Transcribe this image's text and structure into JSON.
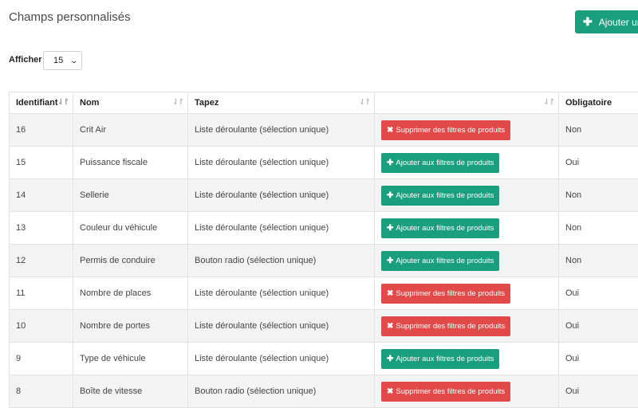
{
  "page": {
    "title": "Champs personnalisés",
    "add_button_label": "Ajouter un ch"
  },
  "length_control": {
    "label": "Afficher",
    "value": "15"
  },
  "table": {
    "columns": [
      "Identifiant",
      "Nom",
      "Tapez",
      "",
      "Obligatoire"
    ],
    "rows": [
      {
        "id": "16",
        "name": "Crit Air",
        "type": "Liste déroulante (sélection unique)",
        "action": "remove",
        "action_label": "Supprimer des filtres de produits",
        "required": "Non"
      },
      {
        "id": "15",
        "name": "Puissance fiscale",
        "type": "Liste déroulante (sélection unique)",
        "action": "add",
        "action_label": "Ajouter aux filtres de produits",
        "required": "Oui"
      },
      {
        "id": "14",
        "name": "Sellerie",
        "type": "Liste déroulante (sélection unique)",
        "action": "add",
        "action_label": "Ajouter aux filtres de produits",
        "required": "Non"
      },
      {
        "id": "13",
        "name": "Couleur du véhicule",
        "type": "Liste déroulante (sélection unique)",
        "action": "add",
        "action_label": "Ajouter aux filtres de produits",
        "required": "Non"
      },
      {
        "id": "12",
        "name": "Permis de conduire",
        "type": "Bouton radio (sélection unique)",
        "action": "add",
        "action_label": "Ajouter aux filtres de produits",
        "required": "Non"
      },
      {
        "id": "11",
        "name": "Nombre de places",
        "type": "Liste déroulante (sélection unique)",
        "action": "remove",
        "action_label": "Supprimer des filtres de produits",
        "required": "Oui"
      },
      {
        "id": "10",
        "name": "Nombre de portes",
        "type": "Liste déroulante (sélection unique)",
        "action": "remove",
        "action_label": "Supprimer des filtres de produits",
        "required": "Oui"
      },
      {
        "id": "9",
        "name": "Type de véhicule",
        "type": "Liste déroulante (sélection unique)",
        "action": "add",
        "action_label": "Ajouter aux filtres de produits",
        "required": "Oui"
      },
      {
        "id": "8",
        "name": "Boîte de vitesse",
        "type": "Bouton radio (sélection unique)",
        "action": "remove",
        "action_label": "Supprimer des filtres de produits",
        "required": "Oui"
      }
    ]
  },
  "colors": {
    "accent_green": "#1a9f7e",
    "danger_red": "#e24a4a"
  },
  "icons": {
    "plus": "plus-icon",
    "times": "times-icon",
    "sort": "sort-icon",
    "chevron": "chevron-down-icon"
  }
}
